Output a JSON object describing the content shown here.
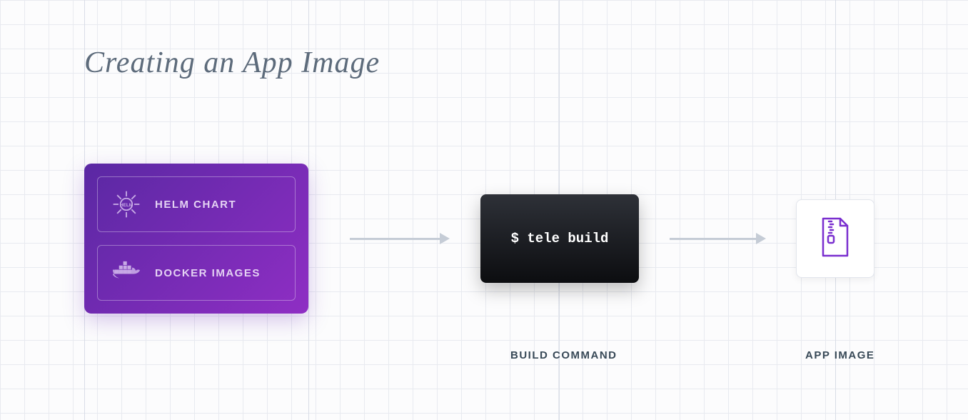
{
  "title": "Creating an App Image",
  "inputs": {
    "helm_label": "HELM CHART",
    "docker_label": "DOCKER IMAGES"
  },
  "terminal": {
    "command": "$ tele build"
  },
  "labels": {
    "build": "BUILD COMMAND",
    "appimage": "APP IMAGE"
  },
  "colors": {
    "purple_gradient_start": "#5a28a3",
    "purple_gradient_end": "#8f2ec4",
    "terminal_bg": "#0c0d10",
    "icon_purple": "#7a2fcf"
  }
}
